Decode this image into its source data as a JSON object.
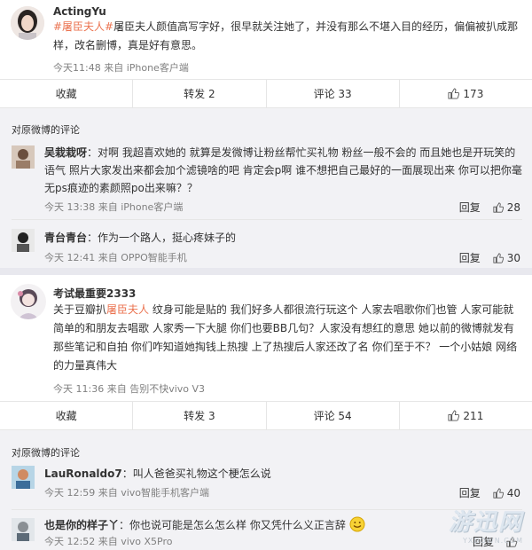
{
  "post1": {
    "username": "ActingYu",
    "topic": "#屠臣夫人#",
    "text": "屠臣夫人颜值高写字好，很早就关注她了，并没有那么不堪入目的经历，偏偏被扒成那样，改名删博，真是好有意思。",
    "meta": "今天11:48 来自 iPhone客户端",
    "actions": {
      "favorite": "收藏",
      "repost": "转发 2",
      "comment": "评论 33",
      "like": "173"
    },
    "comment_box_title": "对原微博的评论",
    "comments": [
      {
        "user": "吴栽栽呀",
        "text": "：对啊 我超喜欢她的 就算是发微博让粉丝帮忙买礼物 粉丝一般不会的 而且她也是开玩笑的语气 照片大家发出来都会加个滤镜啥的吧 肯定会p啊 谁不想把自己最好的一面展现出来 你可以把你毫无ps痕迹的素颜照po出来嘛？？",
        "meta": "今天 13:38 来自 iPhone客户端",
        "reply": "回复",
        "likes": "28"
      },
      {
        "user": "青台青台",
        "text": "：作为一个路人，挺心疼妹子的",
        "meta": "今天 12:41 来自 OPPO智能手机",
        "reply": "回复",
        "likes": "30"
      }
    ]
  },
  "post2": {
    "username": "考试最重要2333",
    "text_prefix": "关于豆瓣扒",
    "topic": "屠臣夫人",
    "text": " 纹身可能是贴的 我们好多人都很流行玩这个 人家去唱歌你们也管 人家可能就简单的和朋友去唱歌 人家秀一下大腿 你们也要BB几句？人家没有想红的意思 她以前的微博就发有那些笔记和自拍 你们咋知道她掏钱上热搜 上了热搜后人家还改了名 你们至于不？ 一个小姑娘 网络的力量真伟大",
    "meta": "今天 11:36 来自 告别不快vivo V3",
    "actions": {
      "favorite": "收藏",
      "repost": "转发 3",
      "comment": "评论 54",
      "like": "211"
    },
    "comment_box_title": "对原微博的评论",
    "comments": [
      {
        "user": "LauRonaldo7",
        "text": "：叫人爸爸买礼物这个梗怎么说",
        "meta": "今天 12:59 来自 vivo智能手机客户端",
        "reply": "回复",
        "likes": "40"
      },
      {
        "user": "也是你的样子丫",
        "text": "：你也说可能是怎么怎么样 你又凭什么义正言辞",
        "meta": "今天 12:52 来自 vivo X5Pro",
        "reply": "回复",
        "likes": ""
      }
    ]
  },
  "watermark": {
    "logo": "游迅网",
    "url": "YXDOWN.COM"
  },
  "colors": {
    "topic": "#eb7350",
    "comment_bg": "#f2f2f5",
    "meta": "#808080"
  },
  "icons": [
    "thumbs-up-icon",
    "smile-emoji-icon"
  ]
}
